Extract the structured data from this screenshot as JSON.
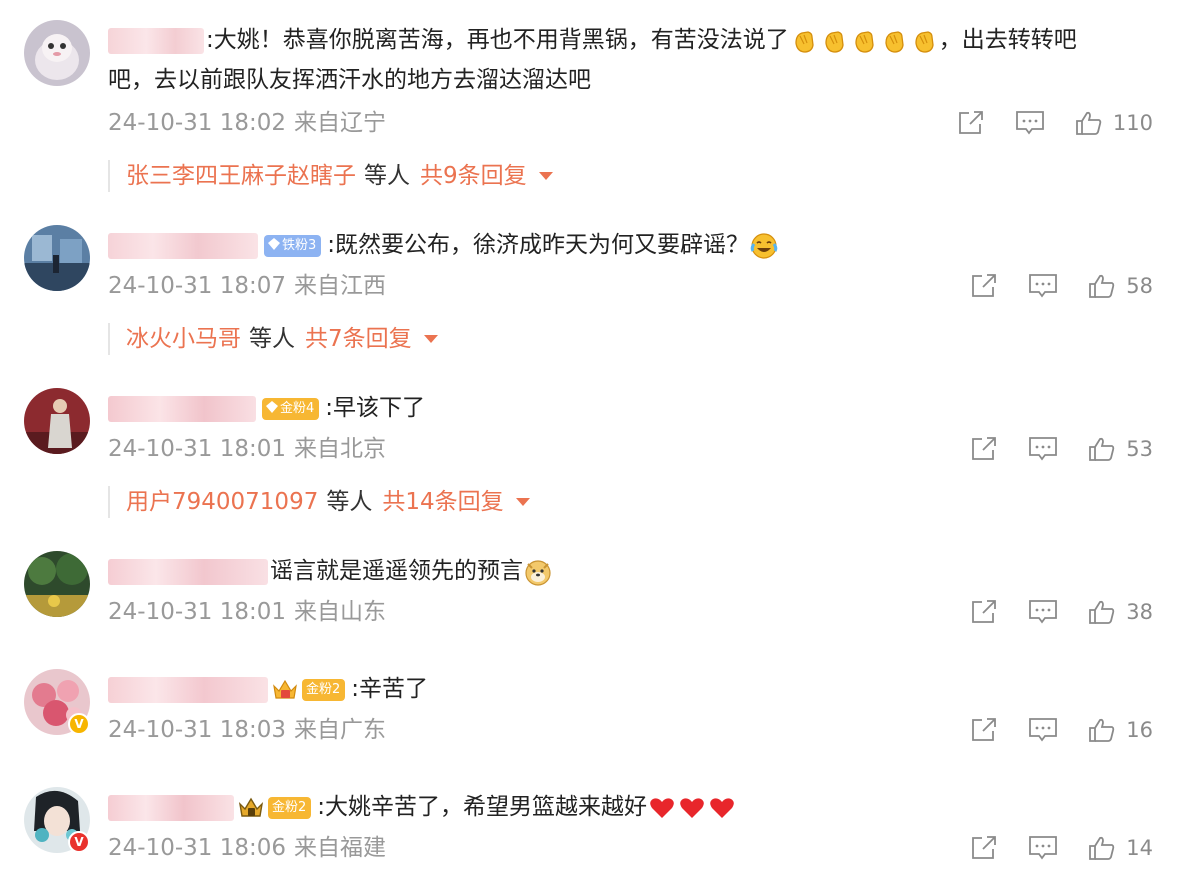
{
  "comments": [
    {
      "text": ":大姚！恭喜你脱离苦海，再也不用背黑锅，有苦没法说了",
      "emoji_name": "clapping-hands-emoji",
      "emoji_count": 5,
      "text_after": "，出去转转吧",
      "text_line2": "吧，去以前跟队友挥洒汗水的地方去溜达溜达吧",
      "time": "24-10-31 18:02",
      "source": "来自辽宁",
      "likes": "110",
      "reply_names": "张三李四王麻子赵瞎子",
      "reply_etal": "等人",
      "reply_total": "共9条回复"
    },
    {
      "badge": "铁粉3",
      "text": ":既然要公布，徐济成昨天为何又要辟谣？",
      "emoji_name": "laugh-cry-emoji",
      "time": "24-10-31 18:07",
      "source": "来自江西",
      "likes": "58",
      "reply_names": "冰火小马哥",
      "reply_etal": "等人",
      "reply_total": "共7条回复"
    },
    {
      "badge": "金粉4",
      "text": ":早该下了",
      "time": "24-10-31 18:01",
      "source": "来自北京",
      "likes": "53",
      "reply_names": "用户7940071097",
      "reply_etal": "等人",
      "reply_total": "共14条回复"
    },
    {
      "text": "谣言就是遥遥领先的预言",
      "emoji_name": "doge-emoji",
      "time": "24-10-31 18:01",
      "source": "来自山东",
      "likes": "38"
    },
    {
      "badge": "金粉2",
      "text": ":辛苦了",
      "time": "24-10-31 18:03",
      "source": "来自广东",
      "likes": "16",
      "avatar_badge": "V"
    },
    {
      "badge": "金粉2",
      "text": ":大姚辛苦了，希望男篮越来越好",
      "emoji_name": "red-heart-emoji",
      "emoji_count": 3,
      "time": "24-10-31 18:06",
      "source": "来自福建",
      "likes": "14",
      "avatar_badge": "V"
    }
  ],
  "icons": {
    "share": "share-icon",
    "comment": "comment-icon",
    "like": "thumbs-up-icon"
  },
  "colors": {
    "accent": "#eb7350",
    "meta": "#999999",
    "iron_badge": "#8db3f2",
    "gold_badge": "#f7b733"
  }
}
